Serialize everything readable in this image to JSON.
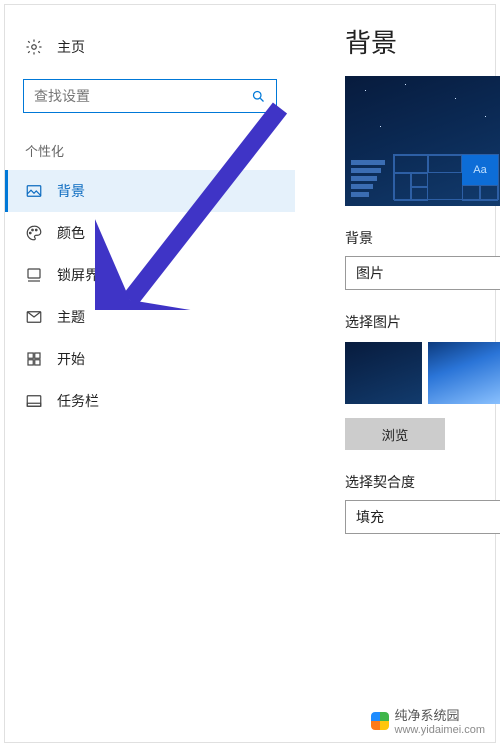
{
  "page_title": "背景",
  "home_label": "主页",
  "search_placeholder": "查找设置",
  "section_label": "个性化",
  "nav": [
    {
      "key": "background",
      "label": "背景",
      "active": true
    },
    {
      "key": "colors",
      "label": "颜色",
      "active": false
    },
    {
      "key": "lockscreen",
      "label": "锁屏界面",
      "active": false
    },
    {
      "key": "themes",
      "label": "主题",
      "active": false
    },
    {
      "key": "start",
      "label": "开始",
      "active": false
    },
    {
      "key": "taskbar",
      "label": "任务栏",
      "active": false
    }
  ],
  "preview_sample_text": "Aa",
  "bg_section_label": "背景",
  "bg_mode_value": "图片",
  "choose_picture_label": "选择图片",
  "browse_label": "浏览",
  "fit_label": "选择契合度",
  "fit_value": "填充",
  "annotation_arrow_target": "themes",
  "watermark_brand": "纯净系统园",
  "watermark_url": "www.yidaimei.com",
  "colors": {
    "accent": "#0078d7",
    "arrow": "#3f34c6"
  }
}
